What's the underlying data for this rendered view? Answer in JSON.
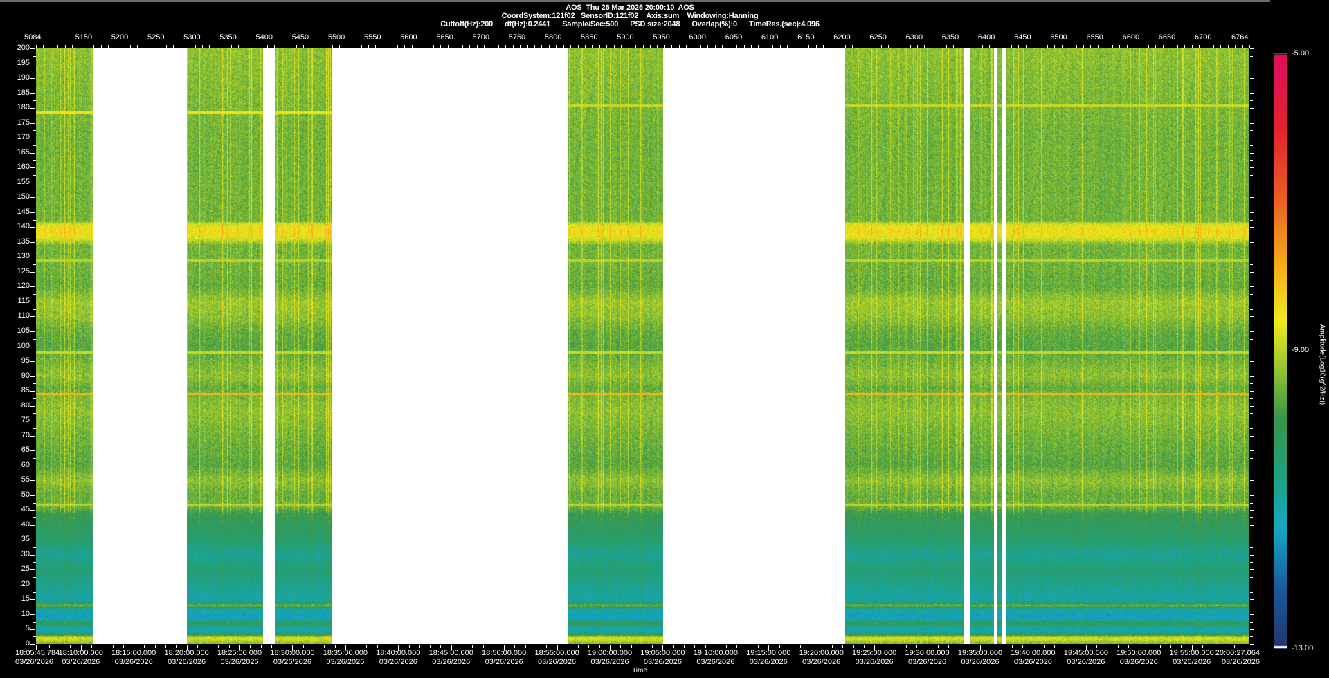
{
  "header": {
    "title": "AOS  Thu 26 Mar 2026 20:00:10  AOS",
    "line2": "CoordSystem:121f02   SensorID:121f02    Axis:sum    Windowing:Hanning",
    "line3": "Cuttoff(Hz):200      df(Hz):0.2441      Sample/Sec:500      PSD size:2048      Overlap(%):0      TimeRes.(sec):4.096"
  },
  "chart_data": {
    "type": "heatmap",
    "xlabel": "Time",
    "colorbar_label": "Amplitude(Log10(g^2/Hz))",
    "top_axis": {
      "range": [
        5084,
        6764
      ],
      "ticks": [
        5084,
        5150,
        5200,
        5250,
        5300,
        5350,
        5400,
        5450,
        5500,
        5550,
        5600,
        5650,
        5700,
        5750,
        5800,
        5850,
        5900,
        5950,
        6000,
        6050,
        6100,
        6150,
        6200,
        6250,
        6300,
        6350,
        6400,
        6450,
        6500,
        6550,
        6600,
        6650,
        6700,
        6764
      ],
      "minor_step": 10
    },
    "y_axis": {
      "range": [
        0,
        200
      ],
      "tick_step": 5,
      "minor_step": 2.5
    },
    "time_ticks": [
      [
        "18:05:45.784",
        "03/26/2026"
      ],
      [
        "18:10:00.000",
        "03/26/2026"
      ],
      [
        "18:15:00.000",
        "03/26/2026"
      ],
      [
        "18:20:00.000",
        "03/26/2026"
      ],
      [
        "18:25:00.000",
        "03/26/2026"
      ],
      [
        "18:30:00.000",
        "03/26/2026"
      ],
      [
        "18:35:00.000",
        "03/26/2026"
      ],
      [
        "18:40:00.000",
        "03/26/2026"
      ],
      [
        "18:45:00.000",
        "03/26/2026"
      ],
      [
        "18:50:00.000",
        "03/26/2026"
      ],
      [
        "18:55:00.000",
        "03/26/2026"
      ],
      [
        "19:00:00.000",
        "03/26/2026"
      ],
      [
        "19:05:00.000",
        "03/26/2026"
      ],
      [
        "19:10:00.000",
        "03/26/2026"
      ],
      [
        "19:15:00.000",
        "03/26/2026"
      ],
      [
        "19:20:00.000",
        "03/26/2026"
      ],
      [
        "19:25:00.000",
        "03/26/2026"
      ],
      [
        "19:30:00.000",
        "03/26/2026"
      ],
      [
        "19:35:00.000",
        "03/26/2026"
      ],
      [
        "19:40:00.000",
        "03/26/2026"
      ],
      [
        "19:45:00.000",
        "03/26/2026"
      ],
      [
        "19:50:00.000",
        "03/26/2026"
      ],
      [
        "19:55:00.000",
        "03/26/2026"
      ],
      [
        "20:00:27.064",
        "03/26/2026"
      ]
    ],
    "data_segments": [
      [
        5084,
        5164
      ],
      [
        5293,
        5398
      ],
      [
        5416,
        5494
      ],
      [
        5821,
        5952
      ],
      [
        6204,
        6369
      ],
      [
        6378,
        6410
      ],
      [
        6415,
        6422
      ],
      [
        6428,
        6764
      ]
    ],
    "colorbar": {
      "min": -13.0,
      "max": -5.0,
      "labels": [
        "-5.00",
        "-9.00",
        "-13.00"
      ]
    },
    "colormap": [
      [
        -13.0,
        "#23366b"
      ],
      [
        -12.2,
        "#1a5a9c"
      ],
      [
        -11.4,
        "#14a8c4"
      ],
      [
        -10.6,
        "#22a07a"
      ],
      [
        -9.9,
        "#3a9648"
      ],
      [
        -9.2,
        "#9cc830"
      ],
      [
        -8.6,
        "#f0ec1c"
      ],
      [
        -7.8,
        "#f6a818"
      ],
      [
        -6.9,
        "#ea5a24"
      ],
      [
        -6.0,
        "#e42230"
      ],
      [
        -5.0,
        "#de0e60"
      ]
    ],
    "frequency_profile": [
      [
        0,
        -9.5
      ],
      [
        2,
        -8.7
      ],
      [
        3.5,
        -10.6
      ],
      [
        5,
        -11.4
      ],
      [
        7,
        -10.0
      ],
      [
        8.5,
        -11.3
      ],
      [
        10,
        -11.4
      ],
      [
        12,
        -10.9
      ],
      [
        13,
        -9.4
      ],
      [
        14,
        -10.6
      ],
      [
        15,
        -11.1
      ],
      [
        20,
        -10.8
      ],
      [
        25,
        -10.5
      ],
      [
        30,
        -10.9
      ],
      [
        35,
        -10.4
      ],
      [
        40,
        -10.2
      ],
      [
        44,
        -10.0
      ],
      [
        46,
        -9.5
      ],
      [
        50,
        -9.6
      ],
      [
        55,
        -9.3
      ],
      [
        60,
        -9.7
      ],
      [
        70,
        -9.5
      ],
      [
        78,
        -9.3
      ],
      [
        82,
        -9.4
      ],
      [
        86,
        -9.6
      ],
      [
        90,
        -9.3
      ],
      [
        95,
        -9.5
      ],
      [
        100,
        -9.7
      ],
      [
        105,
        -9.6
      ],
      [
        110,
        -9.3
      ],
      [
        115,
        -9.2
      ],
      [
        120,
        -9.6
      ],
      [
        128,
        -9.5
      ],
      [
        134,
        -9.5
      ],
      [
        136,
        -8.8
      ],
      [
        138.5,
        -8.4
      ],
      [
        141,
        -8.8
      ],
      [
        142,
        -9.5
      ],
      [
        150,
        -9.5
      ],
      [
        170,
        -9.5
      ],
      [
        200,
        -9.3
      ]
    ],
    "lines": [
      {
        "freq": 178.5,
        "amp": -8.6,
        "from": 5084,
        "to": 5500
      },
      {
        "freq": 181,
        "amp": -8.9,
        "from": 5821,
        "to": 6764
      },
      {
        "freq": 129,
        "amp": -9.0,
        "from": 5084,
        "to": 6764
      },
      {
        "freq": 98,
        "amp": -8.9,
        "from": 5084,
        "to": 6764
      },
      {
        "freq": 84,
        "amp": -8.0,
        "from": 5084,
        "to": 6764
      },
      {
        "freq": 47,
        "amp": -9.0,
        "from": 5084,
        "to": 6764
      }
    ]
  }
}
